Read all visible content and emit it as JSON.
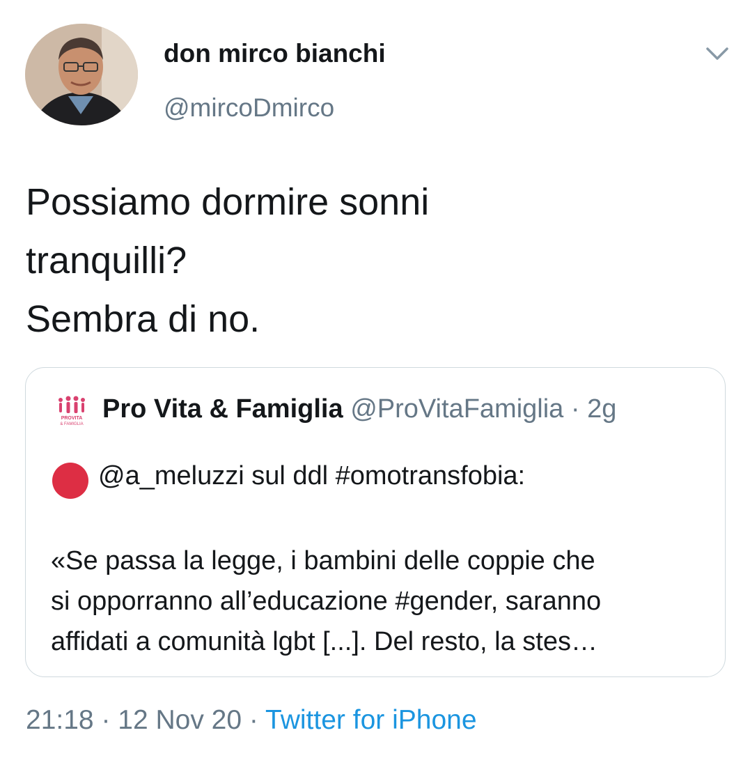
{
  "author": {
    "display_name": "don mirco bianchi",
    "handle": "@mircoDmirco",
    "avatar_icon": "profile-photo"
  },
  "menu_icon": "chevron-down-icon",
  "tweet": {
    "lines": [
      "Possiamo dormire sonni",
      "tranquilli?",
      "Sembra di no."
    ]
  },
  "quoted_tweet": {
    "logo_icon": "provita-logo",
    "logo_text": "PROVITA & FAMIGLIA",
    "display_name": "Pro Vita & Famiglia",
    "handle": "@ProVitaFamiglia",
    "separator": "·",
    "time": "2g",
    "emoji": "red-circle",
    "line1": "@a_meluzzi sul ddl #omotransfobia:",
    "body_lines": [
      "«Se passa la legge, i bambini delle coppie che",
      "si opporranno all’educazione #gender, saranno",
      "affidati a comunità lgbt [...]. Del resto, la stes…"
    ]
  },
  "footer": {
    "time": "21:18",
    "sep1": " · ",
    "date": "12 Nov 20",
    "sep2": " · ",
    "source": "Twitter for iPhone"
  },
  "colors": {
    "text": "#14171a",
    "secondary": "#657786",
    "link": "#1b95e0",
    "border": "#cfd9de",
    "red_dot": "#dd2e44"
  }
}
